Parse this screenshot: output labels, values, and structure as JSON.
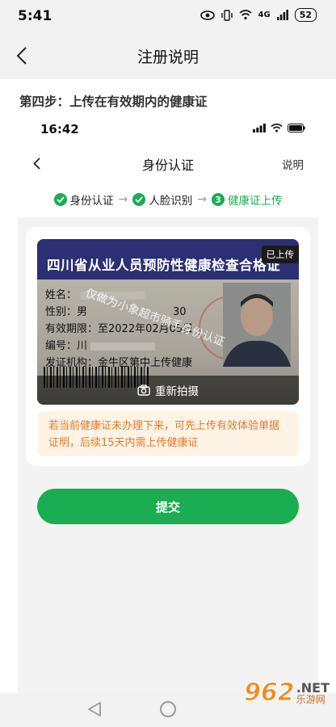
{
  "status_bar": {
    "time": "5:41",
    "battery": "52",
    "network": "4G"
  },
  "header": {
    "title": "注册说明"
  },
  "content": {
    "step_title": "第四步：上传在有效期内的健康证",
    "inner": {
      "status_time": "16:42",
      "nav_title": "身份认证",
      "nav_help": "说明",
      "steps": [
        {
          "label": "身份认证",
          "state": "done"
        },
        {
          "label": "人脸识别",
          "state": "done"
        },
        {
          "number": "3",
          "label": "健康证上传",
          "state": "active"
        }
      ],
      "certificate": {
        "header": "四川省从业人员预防性健康检查合格证",
        "badge": "已上传",
        "watermark": "仅做为小象超市骑手身份认证",
        "fields": {
          "name_label": "姓名：",
          "gender_label": "性别：",
          "gender_value": "男",
          "age_value": "30",
          "valid_label": "有效期限：",
          "valid_value": "至2022年02月05日",
          "id_label": "编号：",
          "id_value": "川",
          "org_label": "发证机构：",
          "org_value": "金牛区第中上传健康"
        },
        "retake_label": "重新拍摄"
      },
      "tip": "若当前健康证未办理下来，可先上传有效体验单据证明，后续15天内需上传健康证",
      "submit_label": "提交"
    }
  },
  "watermark_site": {
    "number": "962",
    "suffix": ".NET",
    "sub": "乐游网"
  },
  "colors": {
    "accent": "#1aad52",
    "tip_text": "#e07b2a",
    "tip_bg": "#fff3e6",
    "cert_header": "#2c2f73"
  }
}
